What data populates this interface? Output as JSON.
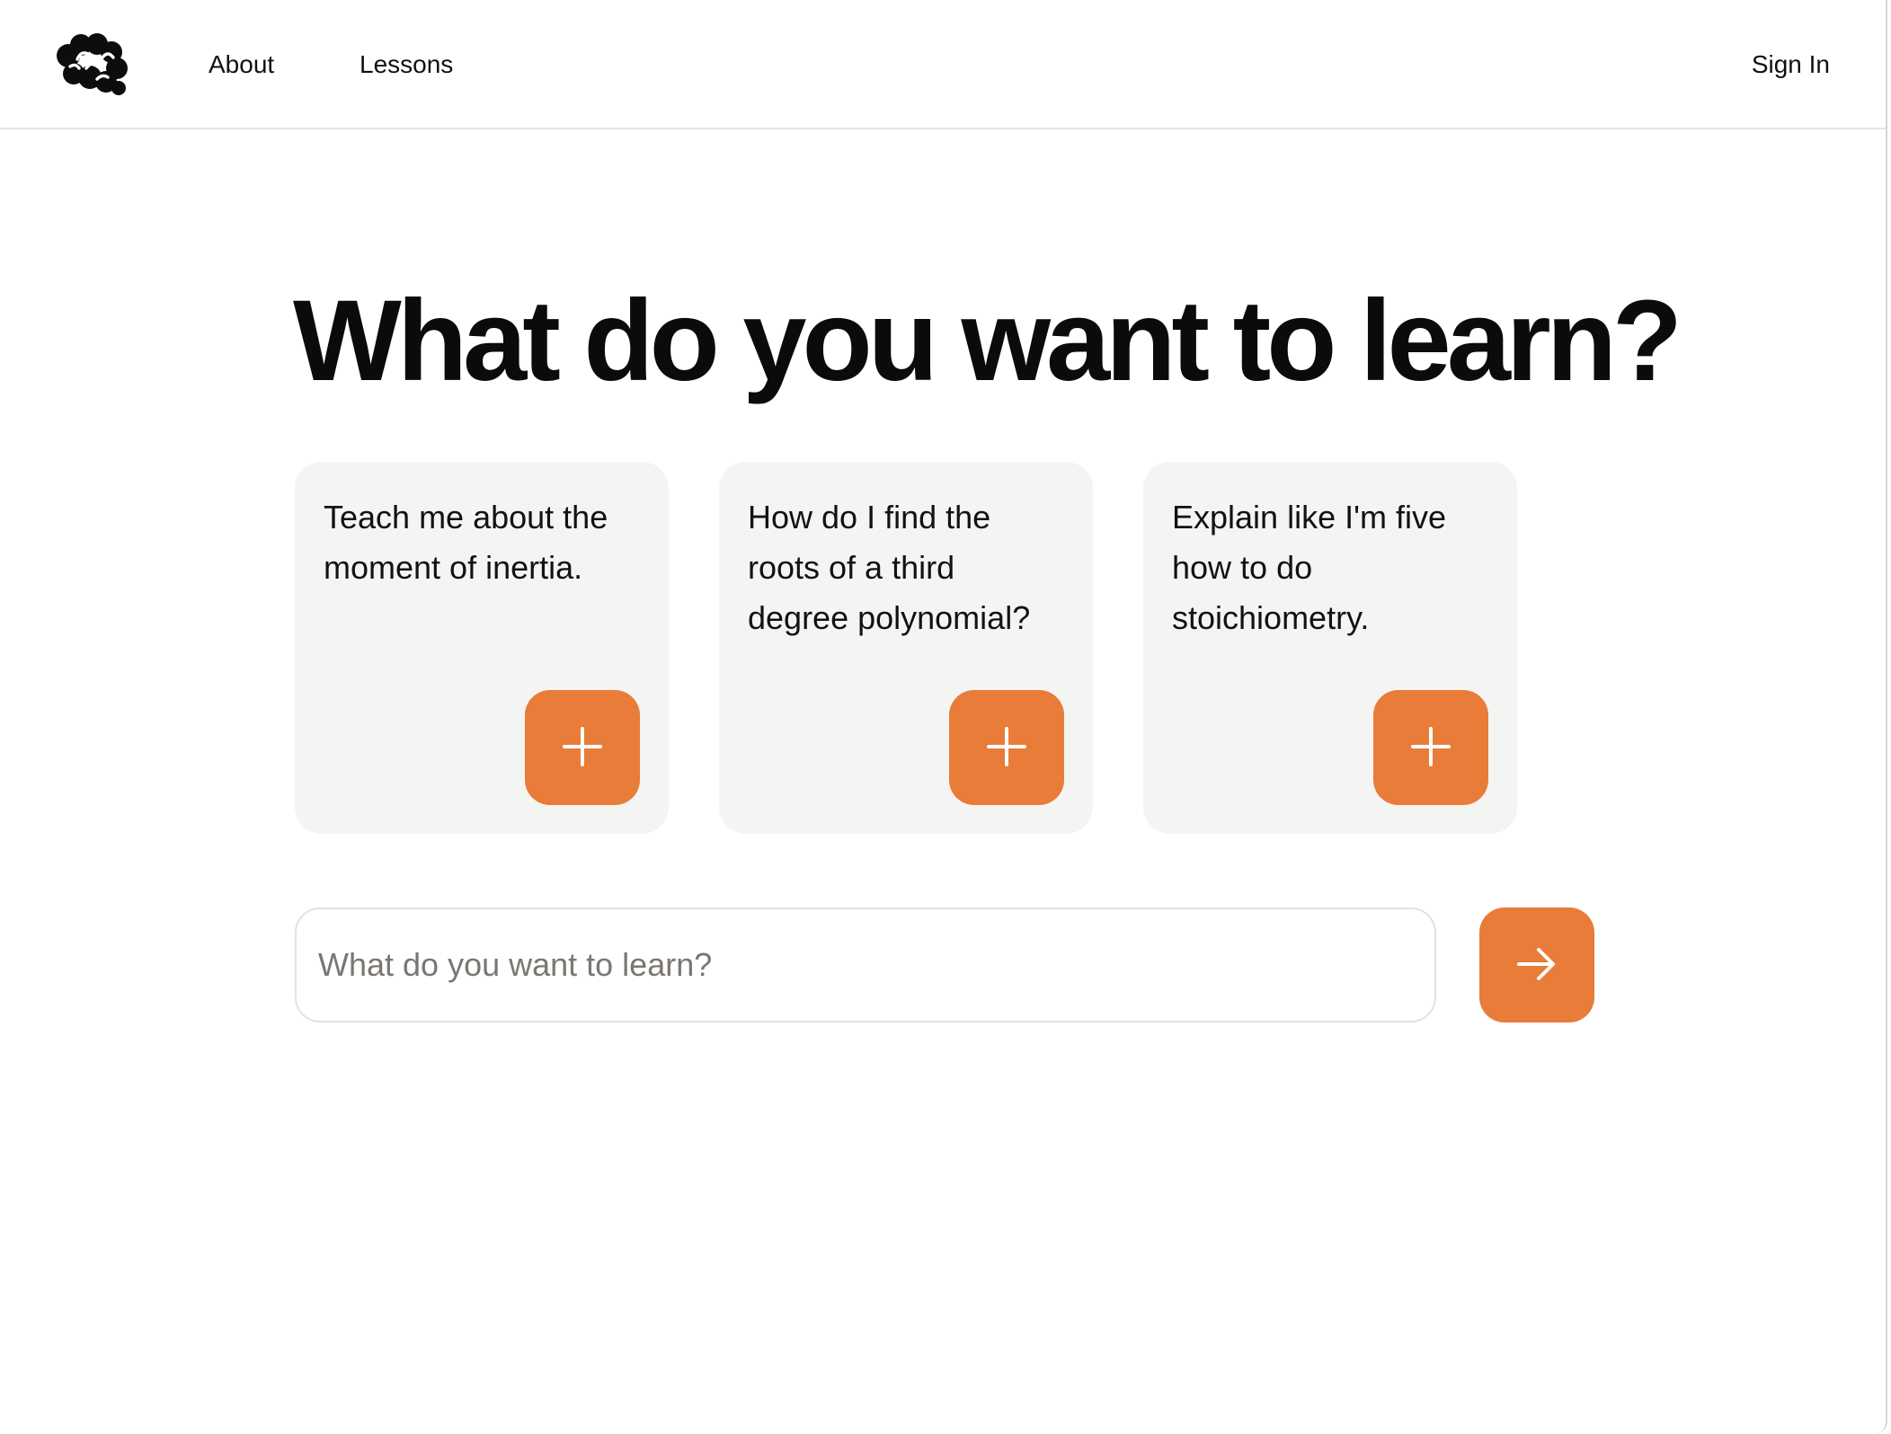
{
  "nav": {
    "links": [
      {
        "label": "About"
      },
      {
        "label": "Lessons"
      }
    ],
    "sign_in_label": "Sign In",
    "logo_icon": "brain-icon"
  },
  "main": {
    "headline": "What do you want to learn?",
    "suggestions": [
      {
        "text": "Teach me about the moment of inertia.",
        "button_icon": "plus-icon"
      },
      {
        "text": "How do I find the roots of a third degree polynomial?",
        "button_icon": "plus-icon"
      },
      {
        "text": "Explain like I'm five how to do stoichiometry.",
        "button_icon": "plus-icon"
      }
    ],
    "search": {
      "placeholder": "What do you want to learn?",
      "value": ""
    },
    "submit_icon": "arrow-right-icon"
  },
  "colors": {
    "accent": "#e87c38",
    "card_background": "#f4f4f3",
    "text": "#111111"
  }
}
